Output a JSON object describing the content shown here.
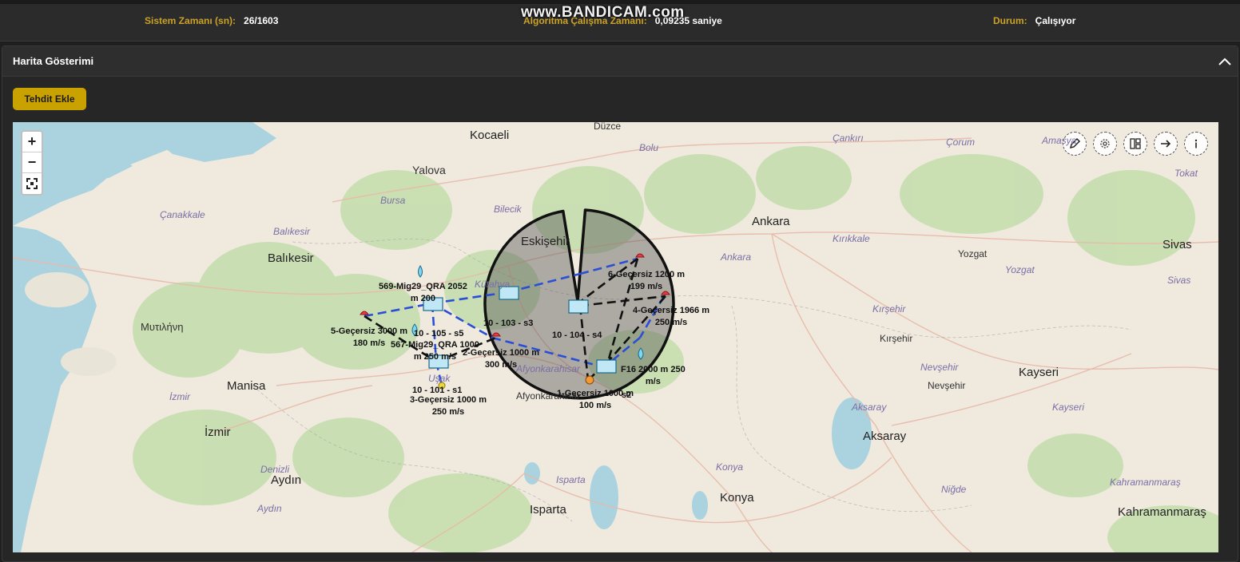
{
  "status": {
    "time_label": "Sistem Zamanı (sn):",
    "time_value": "26/1603",
    "algo_label": "Algoritma Çalışma Zamanı:",
    "algo_value": "0,09235 saniye",
    "state_label": "Durum:",
    "state_value": "Çalışıyor",
    "watermark": "www.BANDICAM.com"
  },
  "panel": {
    "title": "Harita Gösterimi",
    "add_button": "Tehdit Ekle"
  },
  "map": {
    "zoom_in": "+",
    "zoom_out": "−",
    "tools": [
      "pencil-icon",
      "settings-icon",
      "layers-icon",
      "arrow-right-icon",
      "info-icon"
    ],
    "cities": [
      {
        "name": "Yalova"
      },
      {
        "name": "Kocaeli"
      },
      {
        "name": "Düzce"
      },
      {
        "name": "Bolu"
      },
      {
        "name": "Çankırı"
      },
      {
        "name": "Çorum"
      },
      {
        "name": "Amasya"
      },
      {
        "name": "Tokat"
      },
      {
        "name": "Bursa"
      },
      {
        "name": "Bilecik"
      },
      {
        "name": "Çanakkale"
      },
      {
        "name": "Balıkesir"
      },
      {
        "name": "Balıkesir"
      },
      {
        "name": "Eskişehir"
      },
      {
        "name": "Ankara"
      },
      {
        "name": "Ankara"
      },
      {
        "name": "Kırıkkale"
      },
      {
        "name": "Yozgat"
      },
      {
        "name": "Yozgat"
      },
      {
        "name": "Sivas"
      },
      {
        "name": "Sivas"
      },
      {
        "name": "Kırşehir"
      },
      {
        "name": "Kırşehir"
      },
      {
        "name": "Μυτιλήνη"
      },
      {
        "name": "Kütahya"
      },
      {
        "name": "Uşak"
      },
      {
        "name": "Manisa"
      },
      {
        "name": "İzmir"
      },
      {
        "name": "İzmir"
      },
      {
        "name": "Afyonkarahisar"
      },
      {
        "name": "Afyonkarahisar"
      },
      {
        "name": "Nevşehir"
      },
      {
        "name": "Nevşehir"
      },
      {
        "name": "Kayseri"
      },
      {
        "name": "Kayseri"
      },
      {
        "name": "Aksaray"
      },
      {
        "name": "Aksaray"
      },
      {
        "name": "Denizli"
      },
      {
        "name": "Aydın"
      },
      {
        "name": "Aydın"
      },
      {
        "name": "Isparta"
      },
      {
        "name": "Isparta"
      },
      {
        "name": "Konya"
      },
      {
        "name": "Konya"
      },
      {
        "name": "Niğde"
      },
      {
        "name": "Kahramanmaraş"
      },
      {
        "name": "Kahramanmaraş"
      }
    ],
    "labels": [
      {
        "text": "569-Mig29_QRA 2052\nm 200"
      },
      {
        "text": "10 - 105 - s5"
      },
      {
        "text": "5-Geçersiz 3000 m\n180 m/s"
      },
      {
        "text": "567-Mig29_QRA 1000\nm 250 m/s"
      },
      {
        "text": "10 - 103 - s3"
      },
      {
        "text": "6-Geçersiz 1200 m\n199 m/s"
      },
      {
        "text": "4-Geçersiz 1966 m\n250 m/s"
      },
      {
        "text": "10 - 104 - s4"
      },
      {
        "text": "2-Geçersiz 1000 m\n300 m/s"
      },
      {
        "text": "10 - 101 - s1"
      },
      {
        "text": "3-Geçersiz 1000 m\n250 m/s"
      },
      {
        "text": "F16 2000 m 250\nm/s"
      },
      {
        "text": "1-Geçersiz 1000 m\n100 m/s"
      },
      {
        "text": "s2"
      }
    ]
  }
}
